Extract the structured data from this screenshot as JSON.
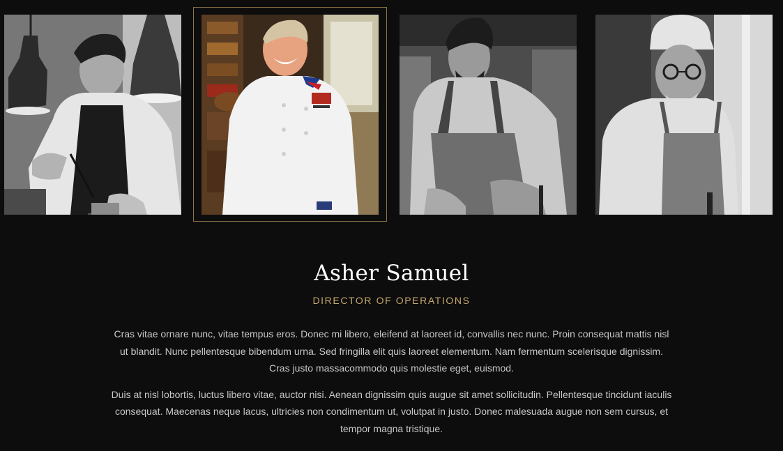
{
  "team_gallery": {
    "members": [
      {
        "id": "chef-1",
        "selected": false
      },
      {
        "id": "asher-samuel",
        "selected": true
      },
      {
        "id": "chef-3",
        "selected": false
      },
      {
        "id": "chef-4",
        "selected": false
      }
    ]
  },
  "profile": {
    "name": "Asher Samuel",
    "role": "DIRECTOR OF OPERATIONS",
    "bio": [
      "Cras vitae ornare nunc, vitae tempus eros. Donec mi libero, eleifend at laoreet id, convallis nec nunc. Proin consequat mattis nisl ut blandit. Nunc pellentesque bibendum urna. Sed fringilla elit quis laoreet elementum. Nam fermentum scelerisque dignissim. Cras justo massacommodo quis molestie eget, euismod.",
      "Duis at nisl lobortis, luctus libero vitae, auctor nisi. Aenean dignissim quis augue sit amet sollicitudin. Pellentesque tincidunt iaculis consequat. Maecenas neque lacus, ultricies non condimentum ut, volutpat in justo. Donec malesuada augue non sem cursus, et tempor magna tristique."
    ]
  },
  "colors": {
    "background": "#0d0d0d",
    "accent_gold": "#c7a76c",
    "frame_gold": "#8a7449",
    "name_text": "#ffffff",
    "body_text": "#c8c8c8"
  }
}
